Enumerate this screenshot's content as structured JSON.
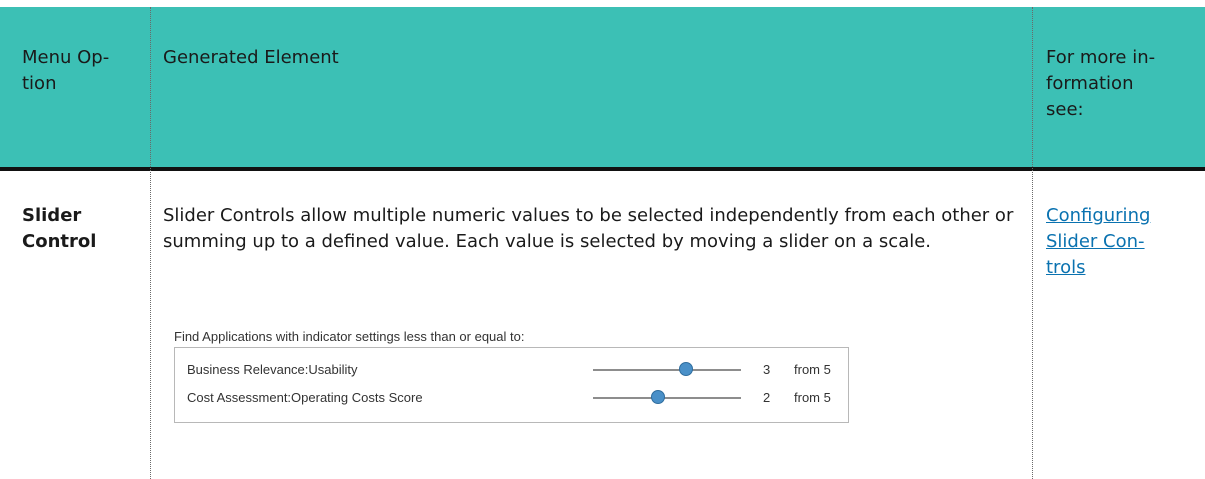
{
  "header": {
    "col1": "Menu Op-\ntion",
    "col2": "Generated Element",
    "col3": "For more in-\nformation\nsee:"
  },
  "row": {
    "option": "Slider\nControl",
    "description": "Slider Controls allow multiple numeric values to be selected independently from each other or summing up to a defined value. Each value is selected by moving a slider on a scale.",
    "link": "Configuring\nSlider Con-\ntrols"
  },
  "widget": {
    "title": "Find Applications with indicator settings less than or equal to:",
    "sliders": [
      {
        "label": "Business Relevance:Usability",
        "value": "3",
        "max_text": "from 5",
        "fraction": 0.63
      },
      {
        "label": "Cost Assessment:Operating Costs Score",
        "value": "2",
        "max_text": "from 5",
        "fraction": 0.44
      }
    ]
  },
  "colors": {
    "header_bg": "#3cc0b5",
    "link": "#0a72b0",
    "slider_thumb": "#4a90c8"
  }
}
